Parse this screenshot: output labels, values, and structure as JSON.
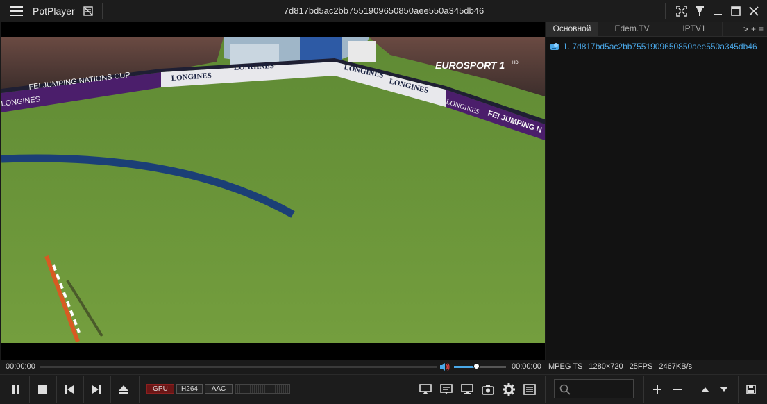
{
  "app": {
    "name": "PotPlayer",
    "window_title": "7d817bd5ac2bb7551909650850aee550a345db46"
  },
  "playlist": {
    "tabs": [
      "Основной",
      "Edem.TV",
      "IPTV1"
    ],
    "tab_controls": [
      ">",
      "+",
      "≡"
    ],
    "items": [
      {
        "label": "1. 7d817bd5ac2bb7551909650850aee550a345db46"
      }
    ]
  },
  "video": {
    "channel_logo": "EUROSPORT 1",
    "channel_logo_suffix": "HD",
    "banners": [
      "LONGINES",
      "LONGINES",
      "LONGINES",
      "LONGINES",
      "LONGINES",
      "LONGINES"
    ],
    "banner_text": "FEI JUMPING NATIONS CUP",
    "banner_text_right": "FEI JUMPING N"
  },
  "playback": {
    "elapsed": "00:00:00",
    "total": "00:00:00",
    "seek_fraction": 0,
    "volume_fraction": 0.42
  },
  "stream_info": {
    "container": "MPEG TS",
    "resolution": "1280×720",
    "fps": "25FPS",
    "bitrate": "2467KB/s"
  },
  "badges": {
    "gpu": "GPU",
    "video_codec": "H264",
    "audio_codec": "AAC"
  },
  "colors": {
    "accent": "#4aa8e8",
    "gpu_badge": "#6b1616",
    "grass": "#6f9a3a",
    "banner_purple": "#4b1e6b"
  },
  "icons": [
    "menu-icon",
    "context-icon",
    "fullscreen-icon",
    "pin-icon",
    "maximize-icon",
    "close-icon",
    "play-pause-icon",
    "stop-icon",
    "previous-icon",
    "next-icon",
    "eject-icon",
    "speaker-icon",
    "airplay-icon",
    "subtitles-icon",
    "monitor-icon",
    "capture-icon",
    "gear-icon",
    "list-icon",
    "search-icon",
    "plus-icon",
    "minus-icon",
    "up-icon",
    "down-icon",
    "save-icon"
  ]
}
